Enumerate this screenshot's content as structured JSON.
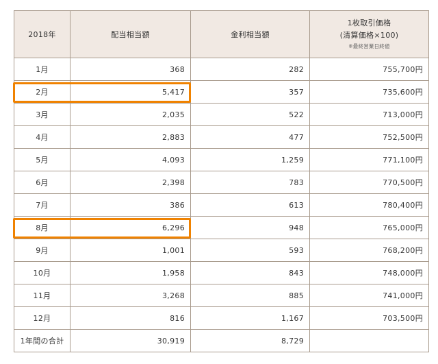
{
  "table": {
    "headers": {
      "year": "2018年",
      "dividend": "配当相当額",
      "interest": "金利相当額",
      "price_line1": "1枚取引価格",
      "price_line2": "(清算価格×100)",
      "price_note": "※最終営業日終値"
    },
    "rows": [
      {
        "month": "1月",
        "dividend": "368",
        "interest": "282",
        "price": "755,700円",
        "highlighted": false
      },
      {
        "month": "2月",
        "dividend": "5,417",
        "interest": "357",
        "price": "735,600円",
        "highlighted": true
      },
      {
        "month": "3月",
        "dividend": "2,035",
        "interest": "522",
        "price": "713,000円",
        "highlighted": false
      },
      {
        "month": "4月",
        "dividend": "2,883",
        "interest": "477",
        "price": "752,500円",
        "highlighted": false
      },
      {
        "month": "5月",
        "dividend": "4,093",
        "interest": "1,259",
        "price": "771,100円",
        "highlighted": false
      },
      {
        "month": "6月",
        "dividend": "2,398",
        "interest": "783",
        "price": "770,500円",
        "highlighted": false
      },
      {
        "month": "7月",
        "dividend": "386",
        "interest": "613",
        "price": "780,400円",
        "highlighted": false
      },
      {
        "month": "8月",
        "dividend": "6,296",
        "interest": "948",
        "price": "765,000円",
        "highlighted": true
      },
      {
        "month": "9月",
        "dividend": "1,001",
        "interest": "593",
        "price": "768,200円",
        "highlighted": false
      },
      {
        "month": "10月",
        "dividend": "1,958",
        "interest": "843",
        "price": "748,000円",
        "highlighted": false
      },
      {
        "month": "11月",
        "dividend": "3,268",
        "interest": "885",
        "price": "741,000円",
        "highlighted": false
      },
      {
        "month": "12月",
        "dividend": "816",
        "interest": "1,167",
        "price": "703,500円",
        "highlighted": false
      }
    ],
    "total": {
      "label": "1年間の合計",
      "dividend": "30,919",
      "interest": "8,729",
      "price": ""
    }
  },
  "colors": {
    "header_bg": "#f1e9e3",
    "border": "#a89a8c",
    "highlight": "#f08200",
    "text": "#333333"
  }
}
